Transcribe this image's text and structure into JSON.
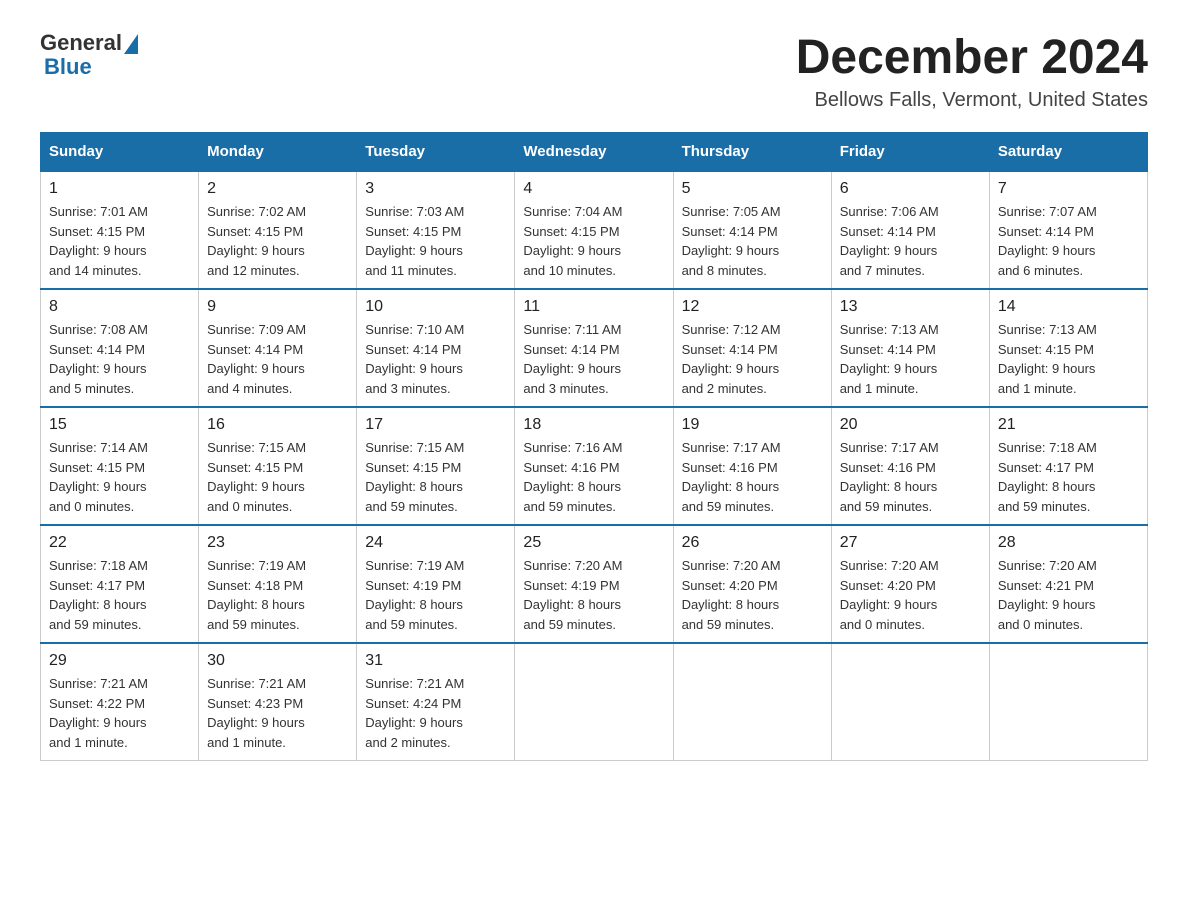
{
  "logo": {
    "general": "General",
    "blue": "Blue"
  },
  "header": {
    "month": "December 2024",
    "location": "Bellows Falls, Vermont, United States"
  },
  "days_of_week": [
    "Sunday",
    "Monday",
    "Tuesday",
    "Wednesday",
    "Thursday",
    "Friday",
    "Saturday"
  ],
  "weeks": [
    [
      {
        "day": "1",
        "sunrise": "7:01 AM",
        "sunset": "4:15 PM",
        "daylight": "9 hours and 14 minutes."
      },
      {
        "day": "2",
        "sunrise": "7:02 AM",
        "sunset": "4:15 PM",
        "daylight": "9 hours and 12 minutes."
      },
      {
        "day": "3",
        "sunrise": "7:03 AM",
        "sunset": "4:15 PM",
        "daylight": "9 hours and 11 minutes."
      },
      {
        "day": "4",
        "sunrise": "7:04 AM",
        "sunset": "4:15 PM",
        "daylight": "9 hours and 10 minutes."
      },
      {
        "day": "5",
        "sunrise": "7:05 AM",
        "sunset": "4:14 PM",
        "daylight": "9 hours and 8 minutes."
      },
      {
        "day": "6",
        "sunrise": "7:06 AM",
        "sunset": "4:14 PM",
        "daylight": "9 hours and 7 minutes."
      },
      {
        "day": "7",
        "sunrise": "7:07 AM",
        "sunset": "4:14 PM",
        "daylight": "9 hours and 6 minutes."
      }
    ],
    [
      {
        "day": "8",
        "sunrise": "7:08 AM",
        "sunset": "4:14 PM",
        "daylight": "9 hours and 5 minutes."
      },
      {
        "day": "9",
        "sunrise": "7:09 AM",
        "sunset": "4:14 PM",
        "daylight": "9 hours and 4 minutes."
      },
      {
        "day": "10",
        "sunrise": "7:10 AM",
        "sunset": "4:14 PM",
        "daylight": "9 hours and 3 minutes."
      },
      {
        "day": "11",
        "sunrise": "7:11 AM",
        "sunset": "4:14 PM",
        "daylight": "9 hours and 3 minutes."
      },
      {
        "day": "12",
        "sunrise": "7:12 AM",
        "sunset": "4:14 PM",
        "daylight": "9 hours and 2 minutes."
      },
      {
        "day": "13",
        "sunrise": "7:13 AM",
        "sunset": "4:14 PM",
        "daylight": "9 hours and 1 minute."
      },
      {
        "day": "14",
        "sunrise": "7:13 AM",
        "sunset": "4:15 PM",
        "daylight": "9 hours and 1 minute."
      }
    ],
    [
      {
        "day": "15",
        "sunrise": "7:14 AM",
        "sunset": "4:15 PM",
        "daylight": "9 hours and 0 minutes."
      },
      {
        "day": "16",
        "sunrise": "7:15 AM",
        "sunset": "4:15 PM",
        "daylight": "9 hours and 0 minutes."
      },
      {
        "day": "17",
        "sunrise": "7:15 AM",
        "sunset": "4:15 PM",
        "daylight": "8 hours and 59 minutes."
      },
      {
        "day": "18",
        "sunrise": "7:16 AM",
        "sunset": "4:16 PM",
        "daylight": "8 hours and 59 minutes."
      },
      {
        "day": "19",
        "sunrise": "7:17 AM",
        "sunset": "4:16 PM",
        "daylight": "8 hours and 59 minutes."
      },
      {
        "day": "20",
        "sunrise": "7:17 AM",
        "sunset": "4:16 PM",
        "daylight": "8 hours and 59 minutes."
      },
      {
        "day": "21",
        "sunrise": "7:18 AM",
        "sunset": "4:17 PM",
        "daylight": "8 hours and 59 minutes."
      }
    ],
    [
      {
        "day": "22",
        "sunrise": "7:18 AM",
        "sunset": "4:17 PM",
        "daylight": "8 hours and 59 minutes."
      },
      {
        "day": "23",
        "sunrise": "7:19 AM",
        "sunset": "4:18 PM",
        "daylight": "8 hours and 59 minutes."
      },
      {
        "day": "24",
        "sunrise": "7:19 AM",
        "sunset": "4:19 PM",
        "daylight": "8 hours and 59 minutes."
      },
      {
        "day": "25",
        "sunrise": "7:20 AM",
        "sunset": "4:19 PM",
        "daylight": "8 hours and 59 minutes."
      },
      {
        "day": "26",
        "sunrise": "7:20 AM",
        "sunset": "4:20 PM",
        "daylight": "8 hours and 59 minutes."
      },
      {
        "day": "27",
        "sunrise": "7:20 AM",
        "sunset": "4:20 PM",
        "daylight": "9 hours and 0 minutes."
      },
      {
        "day": "28",
        "sunrise": "7:20 AM",
        "sunset": "4:21 PM",
        "daylight": "9 hours and 0 minutes."
      }
    ],
    [
      {
        "day": "29",
        "sunrise": "7:21 AM",
        "sunset": "4:22 PM",
        "daylight": "9 hours and 1 minute."
      },
      {
        "day": "30",
        "sunrise": "7:21 AM",
        "sunset": "4:23 PM",
        "daylight": "9 hours and 1 minute."
      },
      {
        "day": "31",
        "sunrise": "7:21 AM",
        "sunset": "4:24 PM",
        "daylight": "9 hours and 2 minutes."
      },
      null,
      null,
      null,
      null
    ]
  ],
  "labels": {
    "sunrise": "Sunrise:",
    "sunset": "Sunset:",
    "daylight": "Daylight:"
  }
}
